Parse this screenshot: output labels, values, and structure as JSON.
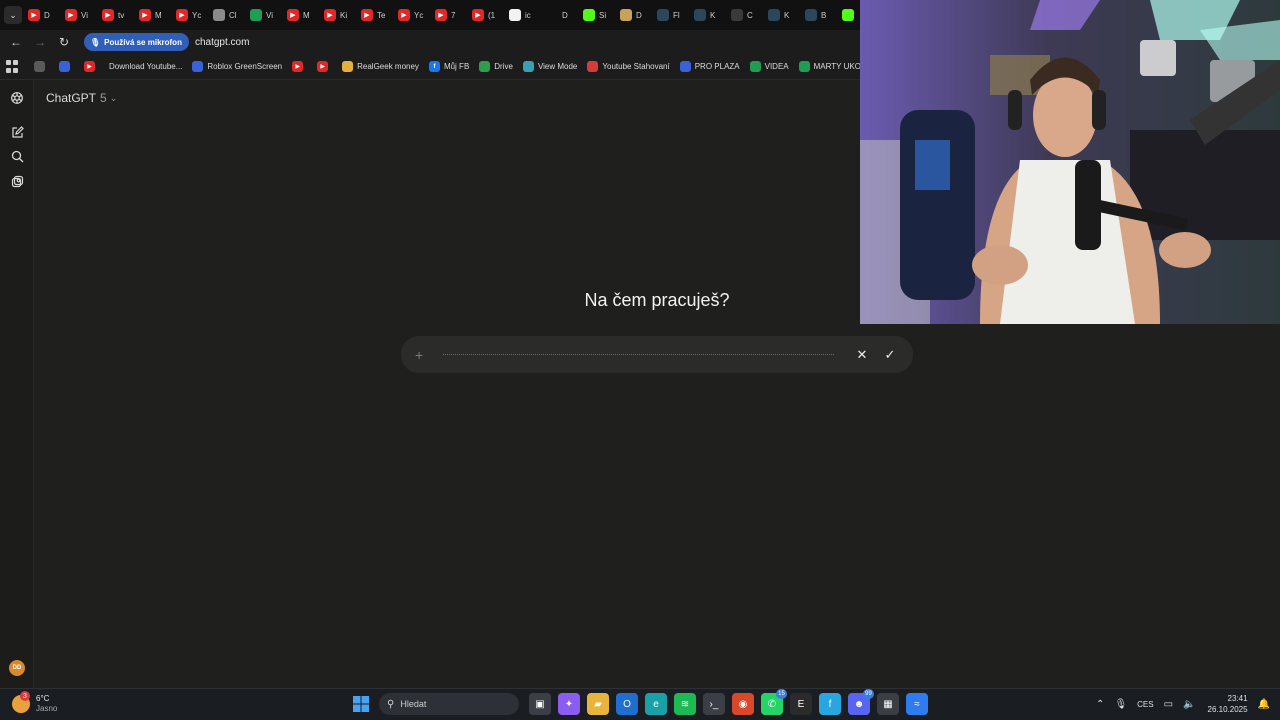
{
  "browser": {
    "tabs": [
      {
        "label": "D",
        "icon": "youtube-icon",
        "color": "#e02828"
      },
      {
        "label": "Vi",
        "icon": "youtube-icon",
        "color": "#e02828"
      },
      {
        "label": "tv",
        "icon": "youtube-icon",
        "color": "#e02828"
      },
      {
        "label": "M",
        "icon": "youtube-icon",
        "color": "#e02828"
      },
      {
        "label": "Yc",
        "icon": "youtube-icon",
        "color": "#e02828"
      },
      {
        "label": "Cl",
        "icon": "image-icon",
        "color": "#8a8a8a"
      },
      {
        "label": "Vi",
        "icon": "sheets-icon",
        "color": "#1f9d55"
      },
      {
        "label": "M",
        "icon": "youtube-icon",
        "color": "#e02828"
      },
      {
        "label": "Ki",
        "icon": "youtube-icon",
        "color": "#e02828"
      },
      {
        "label": "Te",
        "icon": "youtube-icon",
        "color": "#e02828"
      },
      {
        "label": "Yc",
        "icon": "youtube-icon",
        "color": "#e02828"
      },
      {
        "label": "7",
        "icon": "youtube-icon",
        "color": "#e02828"
      },
      {
        "label": "(1",
        "icon": "youtube-icon",
        "color": "#e02828"
      },
      {
        "label": "ic",
        "icon": "chatgpt-icon",
        "color": "#f2f2f2"
      },
      {
        "label": "D",
        "icon": "tiktok-icon",
        "color": "#111111"
      },
      {
        "label": "Si",
        "icon": "kick-icon",
        "color": "#53fc18"
      },
      {
        "label": "D",
        "icon": "dog-icon",
        "color": "#c9a25a"
      },
      {
        "label": "Fl",
        "icon": "steam-icon",
        "color": "#2a475e"
      },
      {
        "label": "K",
        "icon": "steam-icon",
        "color": "#2a475e"
      },
      {
        "label": "C",
        "icon": "check-icon",
        "color": "#3a3a3a"
      },
      {
        "label": "K",
        "icon": "steam-icon",
        "color": "#2a475e"
      },
      {
        "label": "B",
        "icon": "steam-icon",
        "color": "#2a475e"
      },
      {
        "label": "",
        "icon": "kick-icon",
        "color": "#53fc18"
      }
    ],
    "mic_label": "Používá se mikrofon",
    "url": "chatgpt.com",
    "bookmarks": [
      {
        "label": "",
        "icon": "globe-icon",
        "color": "#5a5a5a"
      },
      {
        "label": "",
        "icon": "roblox-icon",
        "color": "#3a62d6"
      },
      {
        "label": "",
        "icon": "youtube-icon",
        "color": "#e02828"
      },
      {
        "label": "Download Youtube...",
        "icon": "",
        "color": "#1c1c1c"
      },
      {
        "label": "Roblox GreenScreen",
        "icon": "roblox-icon",
        "color": "#3a62d6"
      },
      {
        "label": "",
        "icon": "youtube-icon",
        "color": "#e02828"
      },
      {
        "label": "",
        "icon": "youtube-icon",
        "color": "#e02828"
      },
      {
        "label": "RealGeek money",
        "icon": "coin-icon",
        "color": "#e3b23c"
      },
      {
        "label": "Můj FB",
        "icon": "facebook-icon",
        "color": "#1877f2"
      },
      {
        "label": "Drive",
        "icon": "drive-icon",
        "color": "#2e9d4e"
      },
      {
        "label": "View Mode",
        "icon": "view-icon",
        "color": "#3a9fb0"
      },
      {
        "label": "Youtube Stahovaní",
        "icon": "download-icon",
        "color": "#d63b3b"
      },
      {
        "label": "PRO PLAZA",
        "icon": "roblox-icon",
        "color": "#3a62d6"
      },
      {
        "label": "VIDEA",
        "icon": "sheets-icon",
        "color": "#1f9d55"
      },
      {
        "label": "MARTY UKOLY",
        "icon": "sheets-icon",
        "color": "#1f9d55"
      }
    ]
  },
  "app": {
    "model_name": "ChatGPT",
    "model_version": "5",
    "heading": "Na čem pracuješ?",
    "avatar_initials": "DD"
  },
  "taskbar": {
    "temperature": "6°C",
    "weather": "Jasno",
    "weather_badge": "3",
    "search_placeholder": "Hledat",
    "apps": [
      {
        "icon": "windows-icon",
        "color": "#3a8ee6",
        "badge": ""
      },
      {
        "icon": "task-view-icon",
        "color": "#3b3e44",
        "badge": ""
      },
      {
        "icon": "copilot-icon",
        "color": "#8a5cf0",
        "badge": ""
      },
      {
        "icon": "folder-icon",
        "color": "#e9b43b",
        "badge": ""
      },
      {
        "icon": "outlook-icon",
        "color": "#1e6fd0",
        "badge": ""
      },
      {
        "icon": "edge-icon",
        "color": "#1aa1a8",
        "badge": ""
      },
      {
        "icon": "spotify-icon",
        "color": "#1db954",
        "badge": ""
      },
      {
        "icon": "terminal-icon",
        "color": "#3b3e44",
        "badge": ""
      },
      {
        "icon": "chrome-icon",
        "color": "#d9482b",
        "badge": ""
      },
      {
        "icon": "whatsapp-icon",
        "color": "#25d366",
        "badge": "15"
      },
      {
        "icon": "epic-icon",
        "color": "#2b2b2b",
        "badge": ""
      },
      {
        "icon": "file-icon",
        "color": "#27a6e0",
        "badge": ""
      },
      {
        "icon": "discord-icon",
        "color": "#5865f2",
        "badge": "99"
      },
      {
        "icon": "calculator-icon",
        "color": "#3b3e44",
        "badge": ""
      },
      {
        "icon": "app-icon",
        "color": "#2f7cf0",
        "badge": ""
      }
    ],
    "language": "CES",
    "time": "23:41",
    "date": "26.10.2025"
  }
}
